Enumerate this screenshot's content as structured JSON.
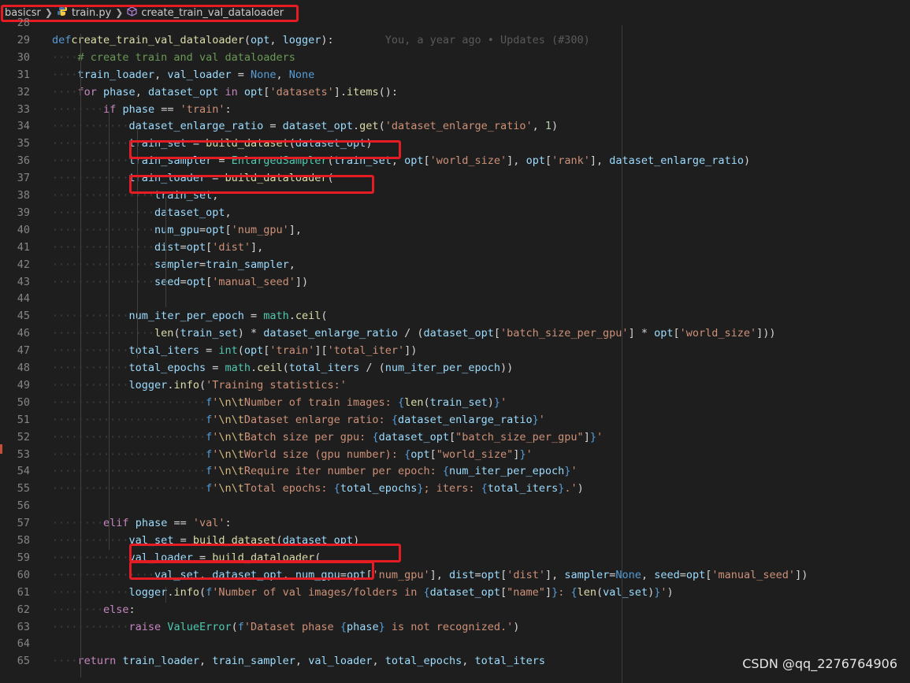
{
  "breadcrumb": {
    "folder": "basicsr",
    "file": "train.py",
    "symbol": "create_train_val_dataloader"
  },
  "blame": "You, a year ago • Updates (#300)",
  "watermark": "CSDN @qq_2276764906",
  "lines": [
    {
      "n": "28",
      "t": [
        [
          "",
          "",
          ""
        ]
      ]
    },
    {
      "n": "29",
      "t": [
        [
          "k",
          "def"
        ],
        [
          "",
          ""
        ],
        [
          "f",
          "create_train_val_dataloader"
        ],
        [
          "",
          "("
        ],
        [
          "v",
          "opt"
        ],
        [
          "",
          ", "
        ],
        [
          "v",
          "logger"
        ],
        [
          "",
          "):"
        ]
      ]
    },
    {
      "n": "30",
      "t": [
        [
          "c",
          "# create train and val dataloaders"
        ]
      ]
    },
    {
      "n": "31",
      "t": [
        [
          "v",
          "train_loader"
        ],
        [
          "",
          ", "
        ],
        [
          "v",
          "val_loader"
        ],
        [
          "",
          " = "
        ],
        [
          "k",
          "None"
        ],
        [
          "",
          ", "
        ],
        [
          "k",
          "None"
        ]
      ]
    },
    {
      "n": "32",
      "t": [
        [
          "kc",
          "for"
        ],
        [
          "",
          " "
        ],
        [
          "v",
          "phase"
        ],
        [
          "",
          ", "
        ],
        [
          "v",
          "dataset_opt"
        ],
        [
          "",
          " "
        ],
        [
          "kc",
          "in"
        ],
        [
          "",
          " "
        ],
        [
          "v",
          "opt"
        ],
        [
          "",
          "["
        ],
        [
          "s",
          "'datasets'"
        ],
        [
          "",
          "]."
        ],
        [
          "f",
          "items"
        ],
        [
          "",
          "():"
        ]
      ]
    },
    {
      "n": "33",
      "t": [
        [
          "kc",
          "if"
        ],
        [
          "",
          " "
        ],
        [
          "v",
          "phase"
        ],
        [
          "",
          " == "
        ],
        [
          "s",
          "'train'"
        ],
        [
          "",
          ":"
        ]
      ]
    },
    {
      "n": "34",
      "t": [
        [
          "v",
          "dataset_enlarge_ratio"
        ],
        [
          "",
          " = "
        ],
        [
          "v",
          "dataset_opt"
        ],
        [
          "",
          "."
        ],
        [
          "f",
          "get"
        ],
        [
          "",
          "("
        ],
        [
          "s",
          "'dataset_enlarge_ratio'"
        ],
        [
          "",
          ", "
        ],
        [
          "n",
          "1"
        ],
        [
          "",
          ")"
        ]
      ]
    },
    {
      "n": "35",
      "t": [
        [
          "v",
          "train_set"
        ],
        [
          "",
          " = "
        ],
        [
          "f",
          "build_dataset"
        ],
        [
          "",
          "("
        ],
        [
          "v",
          "dataset_opt"
        ],
        [
          "",
          ")"
        ]
      ]
    },
    {
      "n": "36",
      "t": [
        [
          "v",
          "train_sampler"
        ],
        [
          "",
          " = "
        ],
        [
          "cl",
          "EnlargedSampler"
        ],
        [
          "",
          "("
        ],
        [
          "v",
          "train_set"
        ],
        [
          "",
          ", "
        ],
        [
          "v",
          "opt"
        ],
        [
          "",
          "["
        ],
        [
          "s",
          "'world_size'"
        ],
        [
          "",
          "], "
        ],
        [
          "v",
          "opt"
        ],
        [
          "",
          "["
        ],
        [
          "s",
          "'rank'"
        ],
        [
          "",
          "], "
        ],
        [
          "v",
          "dataset_enlarge_ratio"
        ],
        [
          "",
          ")"
        ]
      ]
    },
    {
      "n": "37",
      "t": [
        [
          "v",
          "train_loader"
        ],
        [
          "",
          " = "
        ],
        [
          "f",
          "build_dataloader"
        ],
        [
          "",
          "("
        ]
      ]
    },
    {
      "n": "38",
      "t": [
        [
          "v",
          "train_set"
        ],
        [
          "",
          ","
        ]
      ]
    },
    {
      "n": "39",
      "t": [
        [
          "v",
          "dataset_opt"
        ],
        [
          "",
          ","
        ]
      ]
    },
    {
      "n": "40",
      "t": [
        [
          "v",
          "num_gpu"
        ],
        [
          "",
          "="
        ],
        [
          "v",
          "opt"
        ],
        [
          "",
          "["
        ],
        [
          "s",
          "'num_gpu'"
        ],
        [
          "",
          "],"
        ]
      ]
    },
    {
      "n": "41",
      "t": [
        [
          "v",
          "dist"
        ],
        [
          "",
          "="
        ],
        [
          "v",
          "opt"
        ],
        [
          "",
          "["
        ],
        [
          "s",
          "'dist'"
        ],
        [
          "",
          "],"
        ]
      ]
    },
    {
      "n": "42",
      "t": [
        [
          "v",
          "sampler"
        ],
        [
          "",
          "="
        ],
        [
          "v",
          "train_sampler"
        ],
        [
          "",
          ","
        ]
      ]
    },
    {
      "n": "43",
      "t": [
        [
          "v",
          "seed"
        ],
        [
          "",
          "="
        ],
        [
          "v",
          "opt"
        ],
        [
          "",
          "["
        ],
        [
          "s",
          "'manual_seed'"
        ],
        [
          "",
          "])"
        ]
      ]
    },
    {
      "n": "44",
      "t": [
        [
          "",
          ""
        ]
      ]
    },
    {
      "n": "45",
      "t": [
        [
          "v",
          "num_iter_per_epoch"
        ],
        [
          "",
          " = "
        ],
        [
          "cl",
          "math"
        ],
        [
          "",
          "."
        ],
        [
          "f",
          "ceil"
        ],
        [
          "",
          "("
        ]
      ]
    },
    {
      "n": "46",
      "t": [
        [
          "f",
          "len"
        ],
        [
          "",
          "("
        ],
        [
          "v",
          "train_set"
        ],
        [
          "",
          ") * "
        ],
        [
          "v",
          "dataset_enlarge_ratio"
        ],
        [
          "",
          " / ("
        ],
        [
          "v",
          "dataset_opt"
        ],
        [
          "",
          "["
        ],
        [
          "s",
          "'batch_size_per_gpu'"
        ],
        [
          "",
          "] * "
        ],
        [
          "v",
          "opt"
        ],
        [
          "",
          "["
        ],
        [
          "s",
          "'world_size'"
        ],
        [
          "",
          "]))"
        ]
      ]
    },
    {
      "n": "47",
      "t": [
        [
          "v",
          "total_iters"
        ],
        [
          "",
          " = "
        ],
        [
          "cl",
          "int"
        ],
        [
          "",
          "("
        ],
        [
          "v",
          "opt"
        ],
        [
          "",
          "["
        ],
        [
          "s",
          "'train'"
        ],
        [
          "",
          "]["
        ],
        [
          "s",
          "'total_iter'"
        ],
        [
          "",
          "])"
        ]
      ]
    },
    {
      "n": "48",
      "t": [
        [
          "v",
          "total_epochs"
        ],
        [
          "",
          " = "
        ],
        [
          "cl",
          "math"
        ],
        [
          "",
          "."
        ],
        [
          "f",
          "ceil"
        ],
        [
          "",
          "("
        ],
        [
          "v",
          "total_iters"
        ],
        [
          "",
          " / ("
        ],
        [
          "v",
          "num_iter_per_epoch"
        ],
        [
          "",
          "))"
        ]
      ]
    },
    {
      "n": "49",
      "t": [
        [
          "v",
          "logger"
        ],
        [
          "",
          "."
        ],
        [
          "f",
          "info"
        ],
        [
          "",
          "("
        ],
        [
          "s",
          "'Training statistics:'"
        ]
      ]
    },
    {
      "n": "50",
      "t": [
        [
          "k",
          "f"
        ],
        [
          "s",
          "'"
        ],
        [
          "esc",
          "\\n\\t"
        ],
        [
          "s",
          "Number of train images: "
        ],
        [
          "k",
          "{"
        ],
        [
          "f",
          "len"
        ],
        [
          "",
          "("
        ],
        [
          "v",
          "train_set"
        ],
        [
          "",
          ")"
        ],
        [
          "k",
          "}"
        ],
        [
          "s",
          "'"
        ]
      ]
    },
    {
      "n": "51",
      "t": [
        [
          "k",
          "f"
        ],
        [
          "s",
          "'"
        ],
        [
          "esc",
          "\\n\\t"
        ],
        [
          "s",
          "Dataset enlarge ratio: "
        ],
        [
          "k",
          "{"
        ],
        [
          "v",
          "dataset_enlarge_ratio"
        ],
        [
          "k",
          "}"
        ],
        [
          "s",
          "'"
        ]
      ]
    },
    {
      "n": "52",
      "t": [
        [
          "k",
          "f"
        ],
        [
          "s",
          "'"
        ],
        [
          "esc",
          "\\n\\t"
        ],
        [
          "s",
          "Batch size per gpu: "
        ],
        [
          "k",
          "{"
        ],
        [
          "v",
          "dataset_opt"
        ],
        [
          "",
          "["
        ],
        [
          "s",
          "\"batch_size_per_gpu\""
        ],
        [
          "",
          "]"
        ],
        [
          "k",
          "}"
        ],
        [
          "s",
          "'"
        ]
      ]
    },
    {
      "n": "53",
      "t": [
        [
          "k",
          "f"
        ],
        [
          "s",
          "'"
        ],
        [
          "esc",
          "\\n\\t"
        ],
        [
          "s",
          "World size (gpu number): "
        ],
        [
          "k",
          "{"
        ],
        [
          "v",
          "opt"
        ],
        [
          "",
          "["
        ],
        [
          "s",
          "\"world_size\""
        ],
        [
          "",
          "]"
        ],
        [
          "k",
          "}"
        ],
        [
          "s",
          "'"
        ]
      ]
    },
    {
      "n": "54",
      "t": [
        [
          "k",
          "f"
        ],
        [
          "s",
          "'"
        ],
        [
          "esc",
          "\\n\\t"
        ],
        [
          "s",
          "Require iter number per epoch: "
        ],
        [
          "k",
          "{"
        ],
        [
          "v",
          "num_iter_per_epoch"
        ],
        [
          "k",
          "}"
        ],
        [
          "s",
          "'"
        ]
      ]
    },
    {
      "n": "55",
      "t": [
        [
          "k",
          "f"
        ],
        [
          "s",
          "'"
        ],
        [
          "esc",
          "\\n\\t"
        ],
        [
          "s",
          "Total epochs: "
        ],
        [
          "k",
          "{"
        ],
        [
          "v",
          "total_epochs"
        ],
        [
          "k",
          "}"
        ],
        [
          "s",
          "; iters: "
        ],
        [
          "k",
          "{"
        ],
        [
          "v",
          "total_iters"
        ],
        [
          "k",
          "}"
        ],
        [
          "s",
          ".'"
        ],
        [
          "",
          ")"
        ]
      ]
    },
    {
      "n": "56",
      "t": [
        [
          "",
          ""
        ]
      ]
    },
    {
      "n": "57",
      "t": [
        [
          "kc",
          "elif"
        ],
        [
          "",
          " "
        ],
        [
          "v",
          "phase"
        ],
        [
          "",
          " == "
        ],
        [
          "s",
          "'val'"
        ],
        [
          "",
          ":"
        ]
      ]
    },
    {
      "n": "58",
      "t": [
        [
          "v",
          "val_set"
        ],
        [
          "",
          " = "
        ],
        [
          "f",
          "build_dataset"
        ],
        [
          "",
          "("
        ],
        [
          "v",
          "dataset_opt"
        ],
        [
          "",
          ")"
        ]
      ]
    },
    {
      "n": "59",
      "t": [
        [
          "v",
          "val_loader"
        ],
        [
          "",
          " = "
        ],
        [
          "f",
          "build_dataloader"
        ],
        [
          "",
          "("
        ]
      ]
    },
    {
      "n": "60",
      "t": [
        [
          "v",
          "val_set"
        ],
        [
          "",
          ", "
        ],
        [
          "v",
          "dataset_opt"
        ],
        [
          "",
          ", "
        ],
        [
          "v",
          "num_gpu"
        ],
        [
          "",
          "="
        ],
        [
          "v",
          "opt"
        ],
        [
          "",
          "["
        ],
        [
          "s",
          "'num_gpu'"
        ],
        [
          "",
          "], "
        ],
        [
          "v",
          "dist"
        ],
        [
          "",
          "="
        ],
        [
          "v",
          "opt"
        ],
        [
          "",
          "["
        ],
        [
          "s",
          "'dist'"
        ],
        [
          "",
          "], "
        ],
        [
          "v",
          "sampler"
        ],
        [
          "",
          "="
        ],
        [
          "k",
          "None"
        ],
        [
          "",
          ", "
        ],
        [
          "v",
          "seed"
        ],
        [
          "",
          "="
        ],
        [
          "v",
          "opt"
        ],
        [
          "",
          "["
        ],
        [
          "s",
          "'manual_seed'"
        ],
        [
          "",
          "])"
        ]
      ]
    },
    {
      "n": "61",
      "t": [
        [
          "v",
          "logger"
        ],
        [
          "",
          "."
        ],
        [
          "f",
          "info"
        ],
        [
          "",
          "("
        ],
        [
          "k",
          "f"
        ],
        [
          "s",
          "'Number of val images/folders in "
        ],
        [
          "k",
          "{"
        ],
        [
          "v",
          "dataset_opt"
        ],
        [
          "",
          "["
        ],
        [
          "s",
          "\"name\""
        ],
        [
          "",
          "]"
        ],
        [
          "k",
          "}"
        ],
        [
          "s",
          ": "
        ],
        [
          "k",
          "{"
        ],
        [
          "f",
          "len"
        ],
        [
          "",
          "("
        ],
        [
          "v",
          "val_set"
        ],
        [
          "",
          ")"
        ],
        [
          "k",
          "}"
        ],
        [
          "s",
          "'"
        ],
        [
          "",
          ")"
        ]
      ]
    },
    {
      "n": "62",
      "t": [
        [
          "kc",
          "else"
        ],
        [
          "",
          ":"
        ]
      ]
    },
    {
      "n": "63",
      "t": [
        [
          "kc",
          "raise"
        ],
        [
          "",
          " "
        ],
        [
          "cl",
          "ValueError"
        ],
        [
          "",
          "("
        ],
        [
          "k",
          "f"
        ],
        [
          "s",
          "'Dataset phase "
        ],
        [
          "k",
          "{"
        ],
        [
          "v",
          "phase"
        ],
        [
          "k",
          "}"
        ],
        [
          "s",
          " is not recognized.'"
        ],
        [
          "",
          ")"
        ]
      ]
    },
    {
      "n": "64",
      "t": [
        [
          "",
          ""
        ]
      ]
    },
    {
      "n": "65",
      "t": [
        [
          "kc",
          "return"
        ],
        [
          "",
          " "
        ],
        [
          "v",
          "train_loader"
        ],
        [
          "",
          ", "
        ],
        [
          "v",
          "train_sampler"
        ],
        [
          "",
          ", "
        ],
        [
          "v",
          "val_loader"
        ],
        [
          "",
          ", "
        ],
        [
          "v",
          "total_epochs"
        ],
        [
          "",
          ", "
        ],
        [
          "v",
          "total_iters"
        ]
      ]
    }
  ]
}
